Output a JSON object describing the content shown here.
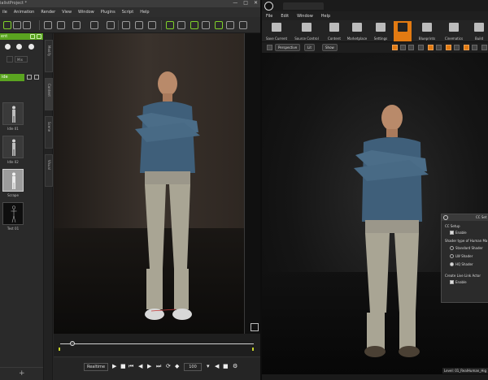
{
  "left_app": {
    "title": "ialistProject *",
    "window_controls": [
      "—",
      "□",
      "✕"
    ],
    "menu": [
      "ile",
      "Animation",
      "Render",
      "View",
      "Window",
      "Plugins",
      "Script",
      "Help"
    ],
    "panel": {
      "header_label": "ent",
      "tab_label": "Mix",
      "green_row_label": "ide",
      "thumbnails": [
        {
          "label": "Idle 01",
          "selected": false
        },
        {
          "label": "Idle 02",
          "selected": false
        },
        {
          "label": "Scrape",
          "selected": true
        },
        {
          "label": "Test 01",
          "selected": false
        }
      ],
      "add_label": "+"
    },
    "side_tabs": [
      "Modify",
      "Content",
      "Scene",
      "Visual"
    ],
    "playbar": {
      "realtime_label": "Realtime",
      "frame_value": "100"
    }
  },
  "right_app": {
    "menu": [
      "File",
      "Edit",
      "Window",
      "Help"
    ],
    "toolbar": [
      {
        "label": "Save Current",
        "highlight": false
      },
      {
        "label": "Source Control",
        "highlight": false
      },
      {
        "label": "Content",
        "highlight": false
      },
      {
        "label": "Marketplace",
        "highlight": false
      },
      {
        "label": "Settings",
        "highlight": false
      },
      {
        "label": "",
        "highlight": true
      },
      {
        "label": "Blueprints",
        "highlight": false
      },
      {
        "label": "Cinematics",
        "highlight": false
      },
      {
        "label": "Build",
        "highlight": false
      }
    ],
    "viewport_bar": {
      "perspective": "Perspective",
      "lit": "Lit",
      "show": "Show"
    },
    "setup_panel": {
      "title": "CC Set",
      "section1": "CC Setup",
      "enable1": "Enable",
      "section2": "Shader type of Human Ma",
      "shaders": [
        {
          "label": "Standard Shader",
          "on": false
        },
        {
          "label": "LW Shader",
          "on": false
        },
        {
          "label": "HQ Shader",
          "on": true
        }
      ],
      "section3": "Create Live Link Actor",
      "enable2": "Enable"
    },
    "level_label": "Level: 01_RealHuman_Hig"
  },
  "colors": {
    "accent_green": "#5aa420",
    "accent_orange": "#e27a12",
    "timeline_marker": "#c6d22a"
  }
}
